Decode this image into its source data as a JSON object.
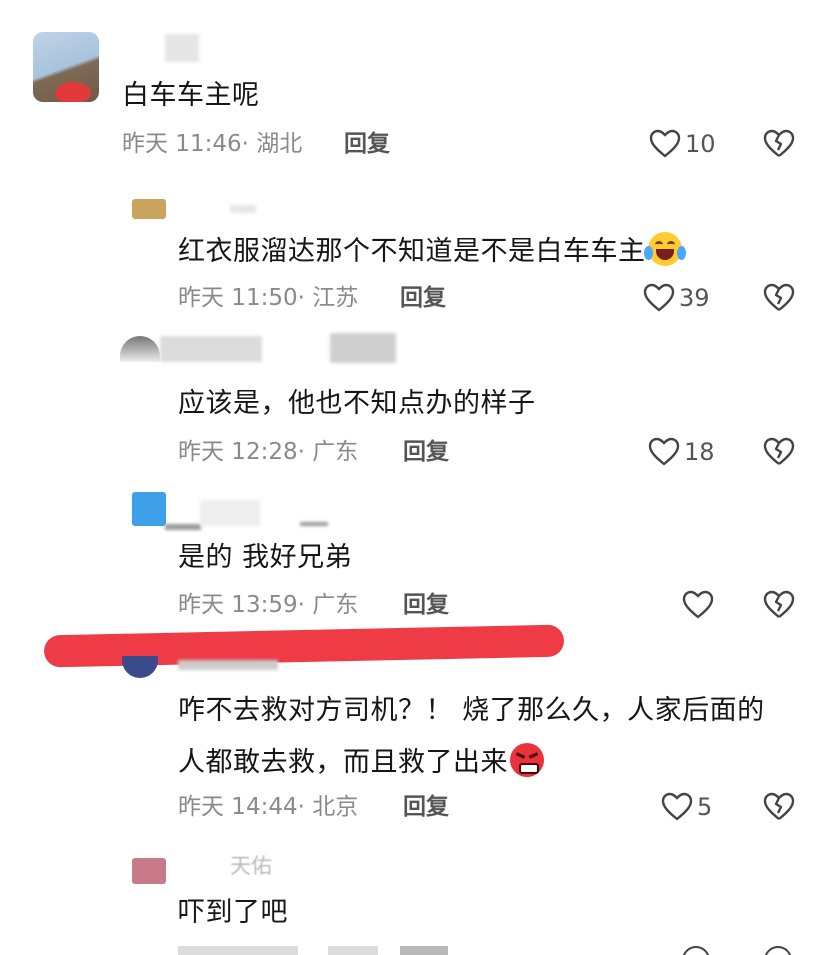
{
  "comments": [
    {
      "text": "白车车主呢",
      "time": "昨天 11:46",
      "region": "湖北",
      "reply": "回复",
      "likes": "10"
    },
    {
      "text": "红衣服溜达那个不知道是不是白车车主",
      "emoji": "laughing-crying-emoji",
      "time": "昨天 11:50",
      "region": "江苏",
      "reply": "回复",
      "likes": "39"
    },
    {
      "text": "应该是，他也不知点办的样子",
      "time": "昨天 12:28",
      "region": "广东",
      "reply": "回复",
      "likes": "18"
    },
    {
      "text": "是的 我好兄弟",
      "time": "昨天 13:59",
      "region": "广东",
      "reply": "回复",
      "likes": ""
    },
    {
      "text_line1": "咋不去救对方司机？！ 烧了那么久，人家后面的",
      "text_line2": "人都敢去救，而且救了出来",
      "emoji": "angry-face-emoji",
      "time": "昨天 14:44",
      "region": "北京",
      "reply": "回复",
      "likes": "5"
    },
    {
      "name": "天佑",
      "text": "吓到了吧"
    }
  ],
  "colors": {
    "redaction": "#ee3b45",
    "meta": "#8a8a8a"
  }
}
